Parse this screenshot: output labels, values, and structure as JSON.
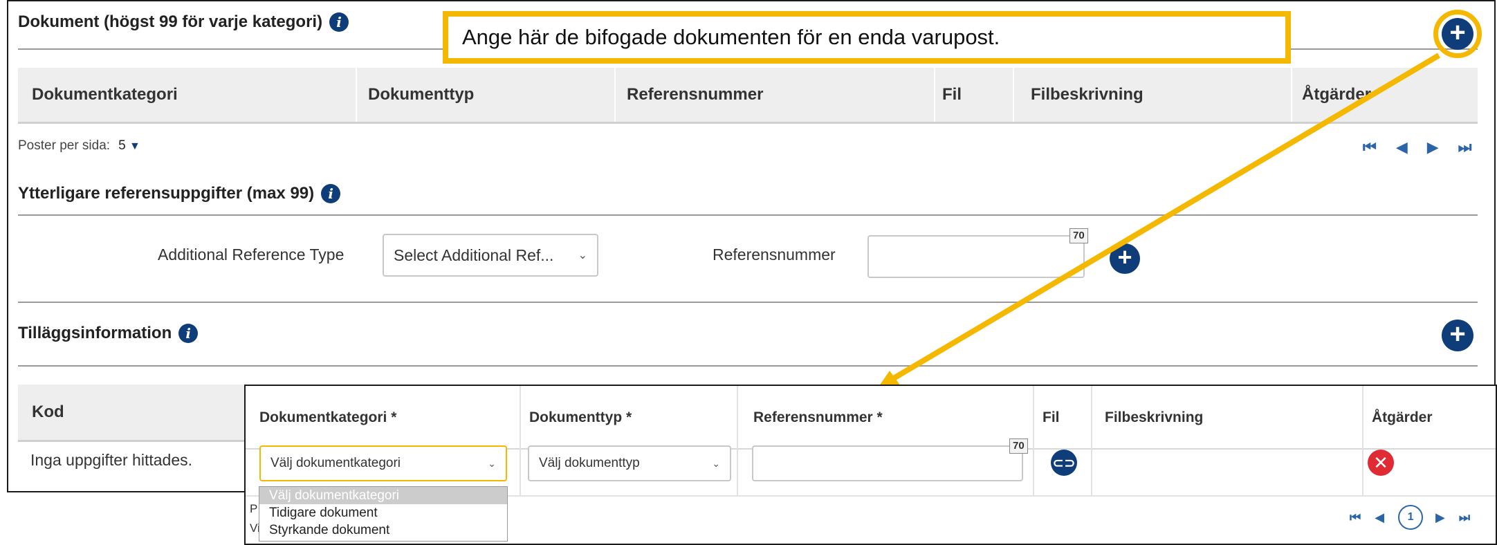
{
  "documents": {
    "title": "Dokument (högst 99 för varje kategori)",
    "columns": [
      "Dokumentkategori",
      "Dokumenttyp",
      "Referensnummer",
      "Fil",
      "Filbeskrivning",
      "Åtgärder"
    ],
    "per_page_label": "Poster per sida:",
    "per_page_value": "5"
  },
  "callout": {
    "text": "Ange här de bifogade dokumenten för en enda varupost."
  },
  "references": {
    "title": "Ytterligare referensuppgifter (max 99)",
    "type_label": "Additional Reference Type",
    "type_placeholder": "Select Additional Ref...",
    "ref_label": "Referensnummer",
    "ref_counter": "70"
  },
  "additional_info": {
    "title": "Tilläggsinformation",
    "column_kod": "Kod",
    "empty_text": "Inga uppgifter hittades."
  },
  "overlay": {
    "columns": [
      "Dokumentkategori *",
      "Dokumenttyp *",
      "Referensnummer *",
      "Fil",
      "Filbeskrivning",
      "Åtgärder"
    ],
    "category_select": "Välj dokumentkategori",
    "type_select": "Välj dokumenttyp",
    "ref_counter": "70",
    "dropdown_options": [
      "Välj dokumentkategori",
      "Tidigare dokument",
      "Styrkande dokument"
    ],
    "page_number": "1",
    "hidden_left_1": "P",
    "hidden_left_2": "Vi"
  },
  "colors": {
    "accent": "#f5b800",
    "primary": "#0f3d7a",
    "danger": "#e02b35"
  }
}
